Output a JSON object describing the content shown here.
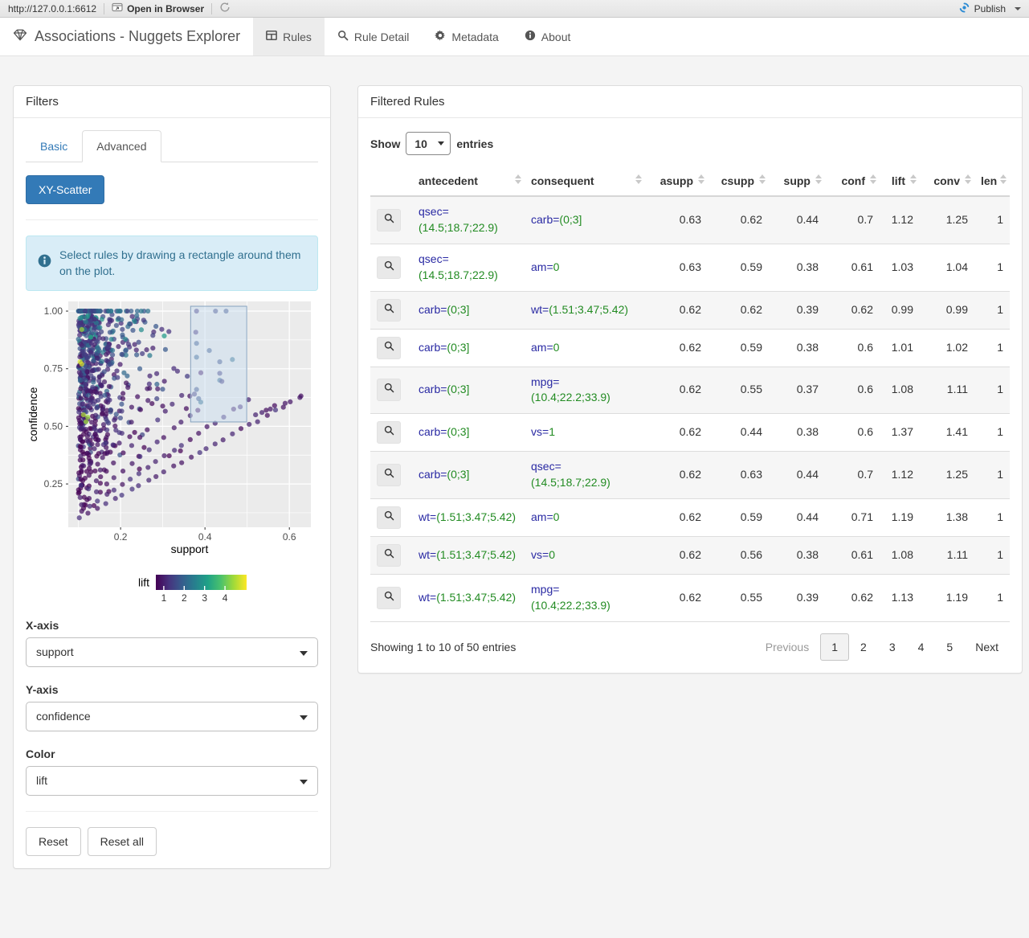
{
  "colors": {
    "primary": "#337ab7",
    "attr_blue": "#2929a3",
    "value_green": "#228b22",
    "alert_text": "#31708f",
    "publish_blue": "#2d8cd4",
    "nav_text": "#555555"
  },
  "viewer_bar": {
    "url": "http://127.0.0.1:6612",
    "open_in_browser": "Open in Browser",
    "publish": "Publish"
  },
  "navbar": {
    "brand": "Associations - Nuggets Explorer",
    "tabs": [
      {
        "label": "Rules",
        "icon": "table-icon",
        "active": true
      },
      {
        "label": "Rule Detail",
        "icon": "search-icon",
        "active": false
      },
      {
        "label": "Metadata",
        "icon": "gear-icon",
        "active": false
      },
      {
        "label": "About",
        "icon": "info-icon",
        "active": false
      }
    ]
  },
  "filters": {
    "title": "Filters",
    "tabs": [
      {
        "label": "Basic",
        "active": false
      },
      {
        "label": "Advanced",
        "active": true
      }
    ],
    "scatter_button": "XY-Scatter",
    "info_text": "Select rules by drawing a rectangle around them on the plot.",
    "xaxis_label": "X-axis",
    "xaxis_value": "support",
    "yaxis_label": "Y-axis",
    "yaxis_value": "confidence",
    "color_label": "Color",
    "color_value": "lift",
    "reset": "Reset",
    "reset_all": "Reset all"
  },
  "rules_panel": {
    "title": "Filtered Rules",
    "show_label": "Show",
    "entries_label": "entries",
    "page_length": "10",
    "columns": [
      "antecedent",
      "consequent",
      "asupp",
      "csupp",
      "supp",
      "conf",
      "lift",
      "conv",
      "len"
    ],
    "rows": [
      {
        "antecedent": {
          "name": "qsec=",
          "value": "(14.5;18.7;22.9)"
        },
        "consequent": {
          "name": "carb=",
          "value": "(0;3]"
        },
        "asupp": "0.63",
        "csupp": "0.62",
        "supp": "0.44",
        "conf": "0.7",
        "lift": "1.12",
        "conv": "1.25",
        "len": "1"
      },
      {
        "antecedent": {
          "name": "qsec=",
          "value": "(14.5;18.7;22.9)"
        },
        "consequent": {
          "name": "am=",
          "value": "0"
        },
        "asupp": "0.63",
        "csupp": "0.59",
        "supp": "0.38",
        "conf": "0.61",
        "lift": "1.03",
        "conv": "1.04",
        "len": "1"
      },
      {
        "antecedent": {
          "name": "carb=",
          "value": "(0;3]"
        },
        "consequent": {
          "name": "wt=",
          "value": "(1.51;3.47;5.42)"
        },
        "asupp": "0.62",
        "csupp": "0.62",
        "supp": "0.39",
        "conf": "0.62",
        "lift": "0.99",
        "conv": "0.99",
        "len": "1"
      },
      {
        "antecedent": {
          "name": "carb=",
          "value": "(0;3]"
        },
        "consequent": {
          "name": "am=",
          "value": "0"
        },
        "asupp": "0.62",
        "csupp": "0.59",
        "supp": "0.38",
        "conf": "0.6",
        "lift": "1.01",
        "conv": "1.02",
        "len": "1"
      },
      {
        "antecedent": {
          "name": "carb=",
          "value": "(0;3]"
        },
        "consequent": {
          "name": "mpg=",
          "value": "(10.4;22.2;33.9)"
        },
        "asupp": "0.62",
        "csupp": "0.55",
        "supp": "0.37",
        "conf": "0.6",
        "lift": "1.08",
        "conv": "1.11",
        "len": "1"
      },
      {
        "antecedent": {
          "name": "carb=",
          "value": "(0;3]"
        },
        "consequent": {
          "name": "vs=",
          "value": "1"
        },
        "asupp": "0.62",
        "csupp": "0.44",
        "supp": "0.38",
        "conf": "0.6",
        "lift": "1.37",
        "conv": "1.41",
        "len": "1"
      },
      {
        "antecedent": {
          "name": "carb=",
          "value": "(0;3]"
        },
        "consequent": {
          "name": "qsec=",
          "value": "(14.5;18.7;22.9)"
        },
        "asupp": "0.62",
        "csupp": "0.63",
        "supp": "0.44",
        "conf": "0.7",
        "lift": "1.12",
        "conv": "1.25",
        "len": "1"
      },
      {
        "antecedent": {
          "name": "wt=",
          "value": "(1.51;3.47;5.42)"
        },
        "consequent": {
          "name": "am=",
          "value": "0"
        },
        "asupp": "0.62",
        "csupp": "0.59",
        "supp": "0.44",
        "conf": "0.71",
        "lift": "1.19",
        "conv": "1.38",
        "len": "1"
      },
      {
        "antecedent": {
          "name": "wt=",
          "value": "(1.51;3.47;5.42)"
        },
        "consequent": {
          "name": "vs=",
          "value": "0"
        },
        "asupp": "0.62",
        "csupp": "0.56",
        "supp": "0.38",
        "conf": "0.61",
        "lift": "1.08",
        "conv": "1.11",
        "len": "1"
      },
      {
        "antecedent": {
          "name": "wt=",
          "value": "(1.51;3.47;5.42)"
        },
        "consequent": {
          "name": "mpg=",
          "value": "(10.4;22.2;33.9)"
        },
        "asupp": "0.62",
        "csupp": "0.55",
        "supp": "0.39",
        "conf": "0.62",
        "lift": "1.13",
        "conv": "1.19",
        "len": "1"
      }
    ],
    "footer": "Showing 1 to 10 of 50 entries",
    "pagination": {
      "previous": "Previous",
      "pages": [
        "1",
        "2",
        "3",
        "4",
        "5"
      ],
      "active": "1",
      "next": "Next"
    }
  },
  "chart_data": {
    "type": "scatter",
    "xlabel": "support",
    "ylabel": "confidence",
    "xlim": [
      0.076,
      0.651
    ],
    "ylim": [
      0.062,
      1.042
    ],
    "x_ticks": [
      0.2,
      0.4,
      0.6
    ],
    "y_ticks": [
      0.25,
      0.5,
      0.75,
      1.0
    ],
    "x_minor": [
      0.1,
      0.3,
      0.5
    ],
    "y_minor": [
      0.125,
      0.375,
      0.625,
      0.875
    ],
    "panel_bg": "#ebebeb",
    "grid_color": "#ffffff",
    "point_alpha": 0.72,
    "point_radius": 3.1,
    "color_scale": {
      "name": "viridis",
      "stops": [
        "#440154",
        "#46327e",
        "#365c8d",
        "#277f8e",
        "#1fa187",
        "#4ac16d",
        "#a0da39",
        "#fde725"
      ]
    },
    "legend": {
      "label": "lift",
      "ticks": [
        1,
        2,
        3,
        4
      ],
      "domain": [
        0.61,
        5.06
      ]
    },
    "selection_rect": {
      "x0": 0.366,
      "x1": 0.499,
      "y0": 0.519,
      "y1": 1.021,
      "fill": "#c9ddf0",
      "fill_alpha": 0.5,
      "stroke": "#87a3bf"
    },
    "generator": {
      "seed": 11,
      "n_cloud": 620,
      "s_min": 0.1,
      "s_scale": 0.052,
      "s_max": 0.42,
      "conf_pow": 0.55,
      "n_top": 48,
      "top_s_scale": 0.045,
      "top_s_max": 0.34,
      "streak_slopes": [
        1.0,
        1.22,
        1.5,
        1.85,
        2.3
      ],
      "streak_max_s": [
        0.64,
        0.52,
        0.4,
        0.36,
        0.33
      ],
      "streak_step": 0.02
    },
    "extra_points": {
      "selected": [
        [
          0.38,
          1.0
        ],
        [
          0.425,
          1.0
        ],
        [
          0.45,
          1.0
        ],
        [
          0.38,
          0.86
        ],
        [
          0.38,
          0.8
        ],
        [
          0.435,
          0.78
        ],
        [
          0.465,
          0.79
        ],
        [
          0.435,
          0.73
        ],
        [
          0.435,
          0.7
        ],
        [
          0.44,
          0.695
        ],
        [
          0.38,
          0.66
        ],
        [
          0.385,
          0.62
        ],
        [
          0.39,
          0.605
        ],
        [
          0.375,
          0.64
        ]
      ],
      "right": [
        [
          0.52,
          0.55
        ],
        [
          0.535,
          0.56
        ],
        [
          0.545,
          0.57
        ],
        [
          0.555,
          0.575
        ],
        [
          0.565,
          0.59
        ],
        [
          0.59,
          0.6
        ],
        [
          0.625,
          0.625
        ]
      ],
      "high_lift": [
        [
          0.104,
          0.78
        ],
        [
          0.108,
          0.77
        ],
        [
          0.112,
          0.55
        ],
        [
          0.118,
          0.52
        ],
        [
          0.122,
          0.54
        ],
        [
          0.108,
          0.92
        ]
      ]
    }
  }
}
